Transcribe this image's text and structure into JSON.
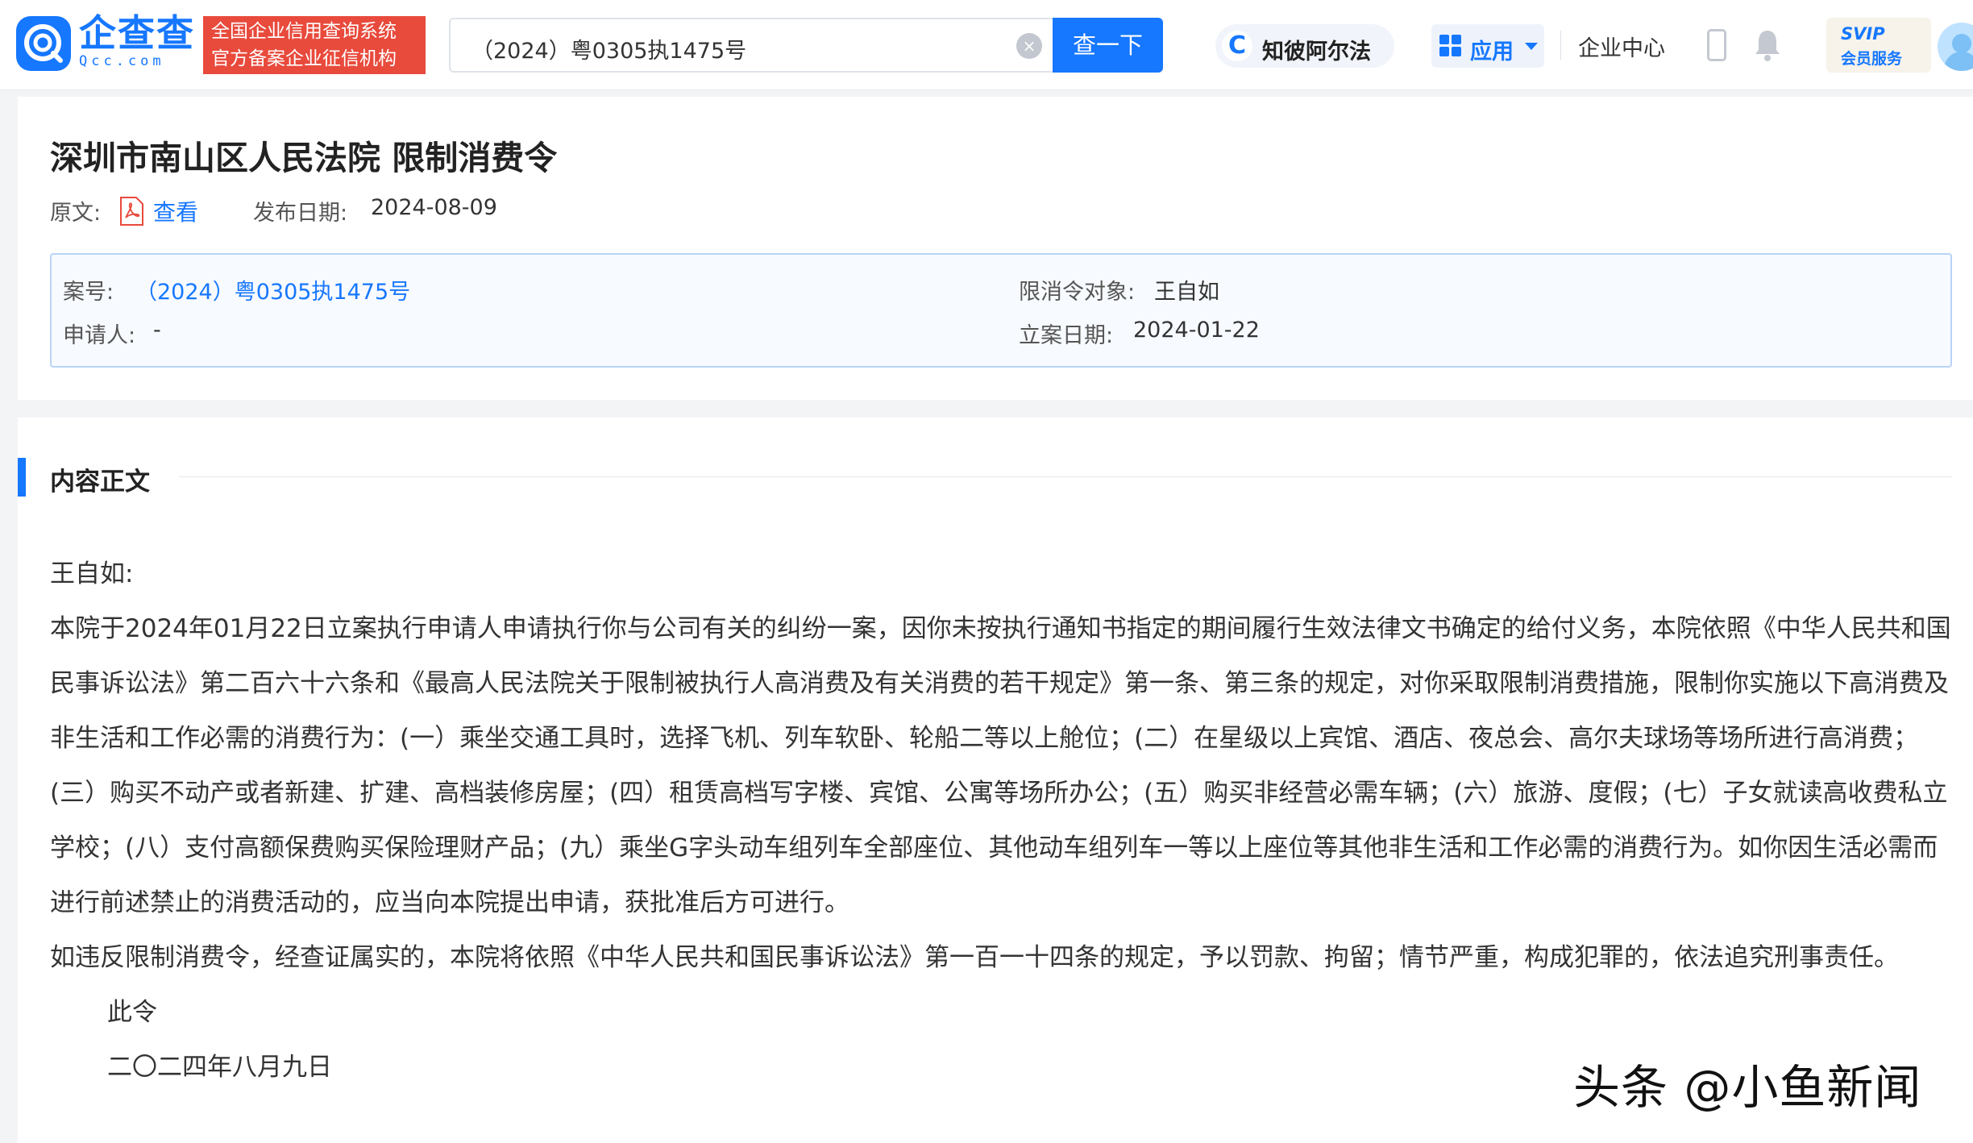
{
  "header": {
    "logo_text": "企查查",
    "logo_sub": "Qcc.com",
    "slogan_line1": "全国企业信用查询系统",
    "slogan_line2": "官方备案企业征信机构",
    "search_value": "（2024）粤0305执1475号",
    "search_button": "查一下",
    "zhibi_label": "知彼阿尔法",
    "apps_label": "应用",
    "enterprise_center": "企业中心",
    "svip_top": "SVIP",
    "svip_bottom": "会员服务",
    "brand_color": "#1677ff",
    "slogan_color": "#e84a3c"
  },
  "document": {
    "title": "深圳市南山区人民法院 限制消费令",
    "original_label": "原文:",
    "view_link": "查看",
    "publish_label": "发布日期:",
    "publish_date": "2024-08-09",
    "case_no_label": "案号:",
    "case_no": "（2024）粤0305执1475号",
    "applicant_label": "申请人:",
    "applicant": "-",
    "target_label": "限消令对象:",
    "target": "王自如",
    "filing_label": "立案日期:",
    "filing_date": "2024-01-22"
  },
  "content": {
    "section_title": "内容正文",
    "salutation": "王自如:",
    "para1": "本院于2024年01月22日立案执行申请人申请执行你与公司有关的纠纷一案，因你未按执行通知书指定的期间履行生效法律文书确定的给付义务，本院依照《中华人民共和国民事诉讼法》第二百六十六条和《最高人民法院关于限制被执行人高消费及有关消费的若干规定》第一条、第三条的规定，对你采取限制消费措施，限制你实施以下高消费及非生活和工作必需的消费行为：(一）乘坐交通工具时，选择飞机、列车软卧、轮船二等以上舱位；(二）在星级以上宾馆、酒店、夜总会、高尔夫球场等场所进行高消费；(三）购买不动产或者新建、扩建、高档装修房屋；(四）租赁高档写字楼、宾馆、公寓等场所办公；(五）购买非经营必需车辆；(六）旅游、度假；(七）子女就读高收费私立学校；(八）支付高额保费购买保险理财产品；(九）乘坐G字头动车组列车全部座位、其他动车组列车一等以上座位等其他非生活和工作必需的消费行为。如你因生活必需而进行前述禁止的消费活动的，应当向本院提出申请，获批准后方可进行。",
    "para2": "如违反限制消费令，经查证属实的，本院将依照《中华人民共和国民事诉讼法》第一百一十四条的规定，予以罚款、拘留；情节严重，构成犯罪的，依法追究刑事责任。",
    "closing": "此令",
    "date_cn": "二〇二四年八月九日"
  },
  "watermark": "头条 @小鱼新闻"
}
